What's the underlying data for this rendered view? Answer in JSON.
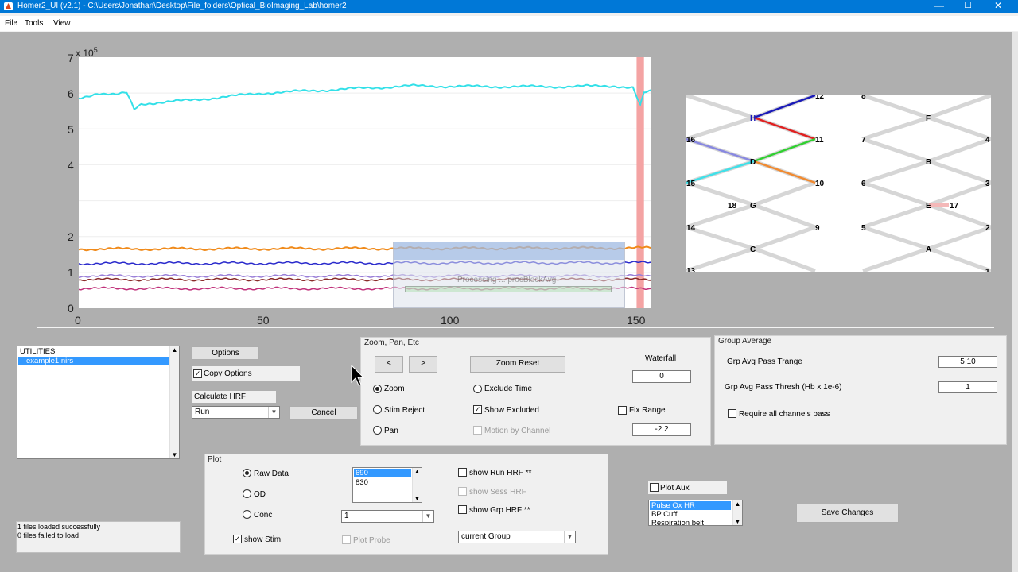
{
  "window": {
    "title": "Homer2_UI  (v2.1) - C:\\Users\\Jonathan\\Desktop\\File_folders\\Optical_BioImaging_Lab\\homer2",
    "minimize": "—",
    "maximize": "☐",
    "close": "✕"
  },
  "menu": [
    "File",
    "Tools",
    "View"
  ],
  "plot_axes": {
    "y_ticks": [
      "0",
      "1",
      "2",
      "4",
      "5",
      "6",
      "7"
    ],
    "x_ticks": [
      "0",
      "50",
      "100",
      "150"
    ],
    "y_exponent": "x 10",
    "y_exponent_power": "5"
  },
  "chart_data": {
    "type": "line",
    "x_range": [
      0,
      155
    ],
    "y_range": [
      0,
      700000
    ],
    "stim_region": [
      151,
      153
    ],
    "stim_color": "#f4a3a3",
    "series": [
      {
        "color": "#33e0e8",
        "values_x": [
          0,
          5,
          10,
          13,
          15,
          17,
          30,
          50,
          70,
          90,
          110,
          130,
          145,
          150,
          152,
          153,
          155
        ],
        "values_y": [
          585000,
          600000,
          595000,
          600000,
          555000,
          570000,
          580000,
          600000,
          610000,
          620000,
          618000,
          618000,
          620000,
          615000,
          565000,
          600000,
          605000
        ]
      },
      {
        "color": "#f08a1a",
        "values_x": [
          0,
          155
        ],
        "values_y": [
          165000,
          168000
        ]
      },
      {
        "color": "#2a2acc",
        "values_x": [
          0,
          155
        ],
        "values_y": [
          125000,
          127000
        ]
      },
      {
        "color": "#9a7fd8",
        "values_x": [
          0,
          155
        ],
        "values_y": [
          90000,
          90000
        ]
      },
      {
        "color": "#8a2a2a",
        "values_x": [
          0,
          155
        ],
        "values_y": [
          80000,
          80000
        ]
      },
      {
        "color": "#c0307a",
        "values_x": [
          0,
          155
        ],
        "values_y": [
          55000,
          55000
        ]
      }
    ]
  },
  "progress_dialog": {
    "text": "Processing ...  procBlockAvg"
  },
  "probe": {
    "labels": [
      "12",
      "11",
      "10",
      "9",
      "16",
      "15",
      "14",
      "13",
      "18",
      "G",
      "C",
      "8",
      "7",
      "6",
      "5",
      "F",
      "B",
      "E",
      "A",
      "17",
      "4",
      "3",
      "2",
      "1",
      "H",
      "D"
    ]
  },
  "utilities": {
    "header": "UTILITIES",
    "files": [
      "example1.nirs"
    ],
    "status": [
      "1 files loaded successfully",
      "0 files failed to load"
    ]
  },
  "options_button": "Options",
  "copy_options": "Copy Options",
  "calculate_hrf": "Calculate HRF",
  "run_select": "Run",
  "cancel_button": "Cancel",
  "zoom_panel": {
    "title": "Zoom, Pan, Etc",
    "prev": "<",
    "next": ">",
    "zoom_reset": "Zoom Reset",
    "waterfall_label": "Waterfall",
    "waterfall_value": "0",
    "zoom": "Zoom",
    "stim_reject": "Stim Reject",
    "pan": "Pan",
    "exclude_time": "Exclude Time",
    "show_excluded": "Show Excluded",
    "motion_by_channel": "Motion by Channel",
    "fix_range": "Fix Range",
    "fix_range_value": "-2 2"
  },
  "group_avg": {
    "title": "Group Average",
    "trange_label": "Grp Avg Pass Trange",
    "trange_value": "5 10",
    "thresh_label": "Grp Avg Pass Thresh (Hb x 1e-6)",
    "thresh_value": "1",
    "require_all": "Require all channels pass"
  },
  "plot_panel": {
    "title": "Plot",
    "raw_data": "Raw Data",
    "od": "OD",
    "conc": "Conc",
    "wavelengths": [
      "690",
      "830"
    ],
    "wl_select": "1",
    "show_stim": "show Stim",
    "plot_probe": "Plot Probe",
    "show_run_hrf": "show Run HRF **",
    "show_sess_hrf": "show Sess HRF",
    "show_grp_hrf": "show Grp HRF **",
    "group_select": "current Group"
  },
  "plot_aux": {
    "label": "Plot Aux",
    "items": [
      "Pulse Ox HR",
      "BP Cuff",
      "Respiration belt"
    ]
  },
  "save_changes": "Save Changes",
  "scroll_arrows": {
    "up": "▲",
    "down": "▼"
  }
}
